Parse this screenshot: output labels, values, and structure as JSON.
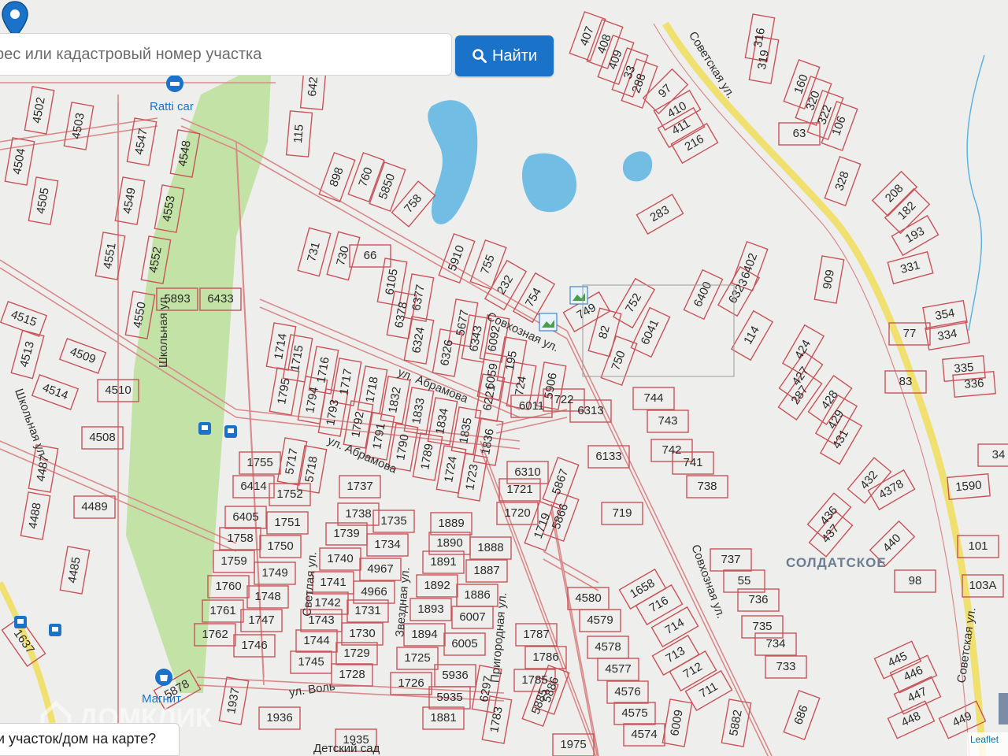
{
  "search": {
    "placeholder": "рес или кадастровый номер участка",
    "button_label": "Найти"
  },
  "bottom_prompt": "и участок/дом на карте?",
  "watermark_text": "ДОМКЛИК",
  "attribution": "Leaflet",
  "colors": {
    "plot_line": "#c8545a",
    "road_line": "#d98a8a",
    "water": "#5bb4e3",
    "park": "#c3e3a6",
    "highway": "#f0e070",
    "button": "#1a73c8",
    "marker": "#1a73c8",
    "map_background": "#eeeeec"
  },
  "map": {
    "streets": [
      "Советская ул.",
      "Советская ул.",
      "Совхозная ул.",
      "Совхозная ул.",
      "ул. Абрамова",
      "ул. Абрамова",
      "Школьная ул.",
      "Школьная ул.",
      "Светлая ул.",
      "Звездная ул.",
      "Пригородная ул.",
      "ул. Воль"
    ],
    "places": [
      "Ratti car",
      "Магнит",
      "Детский сад"
    ],
    "area_name": "СОЛДАТСКОЕ",
    "plot_numbers": [
      "4502",
      "4503",
      "4504",
      "4505",
      "4547",
      "4548",
      "4549",
      "4553",
      "4551",
      "4552",
      "4550",
      "4515",
      "4513",
      "4509",
      "4514",
      "4510",
      "4508",
      "4487",
      "4489",
      "4488",
      "4485",
      "1637",
      "5893",
      "6433",
      "115",
      "642",
      "898",
      "760",
      "5850",
      "758",
      "731",
      "730",
      "66",
      "5910",
      "755",
      "232",
      "754",
      "6105",
      "6378",
      "6377",
      "6324",
      "6326",
      "5677",
      "6343",
      "6092",
      "195",
      "724",
      "6059",
      "6221",
      "6011",
      "5906",
      "722",
      "6313",
      "6133",
      "407",
      "408",
      "409",
      "288",
      "33",
      "97",
      "410",
      "411",
      "216",
      "283",
      "316",
      "319",
      "160",
      "320",
      "322",
      "106",
      "63",
      "328",
      "208",
      "182",
      "193",
      "331",
      "909",
      "354",
      "334",
      "335",
      "336",
      "34",
      "1590",
      "101",
      "103A",
      "98",
      "77",
      "83",
      "82",
      "750",
      "749",
      "752",
      "6041",
      "6400",
      "6402",
      "6323",
      "114",
      "424",
      "427",
      "287",
      "428",
      "429",
      "431",
      "432",
      "436",
      "437",
      "4378",
      "440",
      "744",
      "743",
      "742",
      "741",
      "738",
      "719",
      "1714",
      "1715",
      "1716",
      "1717",
      "1718",
      "1795",
      "1794",
      "1793",
      "1792",
      "1791",
      "1790",
      "1789",
      "1832",
      "1833",
      "1834",
      "1835",
      "1836",
      "1724",
      "1723",
      "1755",
      "5717",
      "5718",
      "6414",
      "1752",
      "6405",
      "1751",
      "1758",
      "1750",
      "1759",
      "1749",
      "1760",
      "1748",
      "1761",
      "1747",
      "1762",
      "1746",
      "1737",
      "1738",
      "1735",
      "1739",
      "1734",
      "1740",
      "4967",
      "1741",
      "4966",
      "1742",
      "1731",
      "1743",
      "1730",
      "1744",
      "1729",
      "1745",
      "1728",
      "1889",
      "1890",
      "1888",
      "1891",
      "1887",
      "1892",
      "1886",
      "1893",
      "6007",
      "1894",
      "6005",
      "1725",
      "1726",
      "5936",
      "5935",
      "1881",
      "6310",
      "5867",
      "1721",
      "1720",
      "1719",
      "5866",
      "1787",
      "1786",
      "1785",
      "5886",
      "5885",
      "6297",
      "1783",
      "4580",
      "4579",
      "4578",
      "4577",
      "4576",
      "4575",
      "4574",
      "1658",
      "716",
      "714",
      "713",
      "712",
      "711",
      "6009",
      "5882",
      "737",
      "55",
      "736",
      "735",
      "734",
      "733",
      "686",
      "445",
      "446",
      "447",
      "448",
      "449",
      "5878",
      "1937",
      "1936",
      "1935",
      "1975"
    ]
  }
}
